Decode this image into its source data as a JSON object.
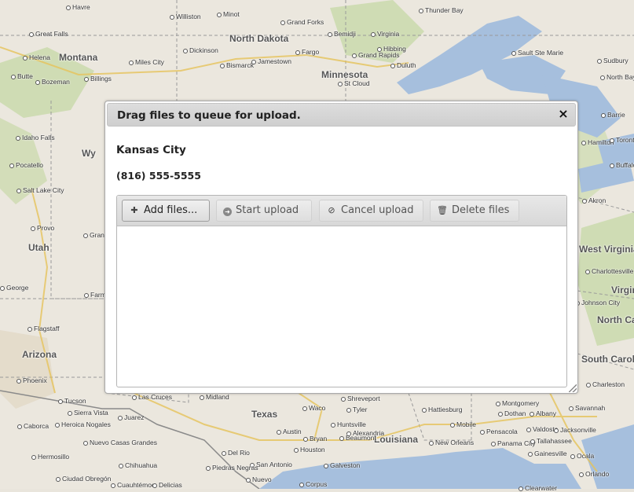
{
  "map": {
    "labels": [
      {
        "text": "Havre",
        "cls": ""
      },
      {
        "text": "Williston",
        "cls": ""
      },
      {
        "text": "Minot",
        "cls": ""
      },
      {
        "text": "Grand Forks",
        "cls": ""
      },
      {
        "text": "Thunder Bay",
        "cls": ""
      },
      {
        "text": "Great Falls",
        "cls": ""
      },
      {
        "text": "North Dakota",
        "cls": "state"
      },
      {
        "text": "Bemidji",
        "cls": ""
      },
      {
        "text": "Virginia",
        "cls": ""
      },
      {
        "text": "Montana",
        "cls": "state"
      },
      {
        "text": "Helena",
        "cls": ""
      },
      {
        "text": "Miles City",
        "cls": ""
      },
      {
        "text": "Dickinson",
        "cls": ""
      },
      {
        "text": "Bismarck",
        "cls": ""
      },
      {
        "text": "Jamestown",
        "cls": ""
      },
      {
        "text": "Fargo",
        "cls": ""
      },
      {
        "text": "Grand Rapids",
        "cls": ""
      },
      {
        "text": "Hibbing",
        "cls": ""
      },
      {
        "text": "Duluth",
        "cls": ""
      },
      {
        "text": "Sault Ste Marie",
        "cls": ""
      },
      {
        "text": "Sudbury",
        "cls": ""
      },
      {
        "text": "Butte",
        "cls": ""
      },
      {
        "text": "Bozeman",
        "cls": ""
      },
      {
        "text": "Billings",
        "cls": ""
      },
      {
        "text": "Minnesota",
        "cls": "state"
      },
      {
        "text": "St Cloud",
        "cls": ""
      },
      {
        "text": "North Bay",
        "cls": ""
      },
      {
        "text": "Idaho Falls",
        "cls": ""
      },
      {
        "text": "Wy",
        "cls": "state"
      },
      {
        "text": "Pocatello",
        "cls": ""
      },
      {
        "text": "Salt Lake City",
        "cls": ""
      },
      {
        "text": "Provo",
        "cls": ""
      },
      {
        "text": "Utah",
        "cls": "state"
      },
      {
        "text": "George",
        "cls": ""
      },
      {
        "text": "Flagstaff",
        "cls": ""
      },
      {
        "text": "Arizona",
        "cls": "state"
      },
      {
        "text": "Phoenix",
        "cls": ""
      },
      {
        "text": "Tucson",
        "cls": ""
      },
      {
        "text": "Sierra Vista",
        "cls": ""
      },
      {
        "text": "Caborca",
        "cls": ""
      },
      {
        "text": "Heroica Nogales",
        "cls": ""
      },
      {
        "text": "Las Cruces",
        "cls": ""
      },
      {
        "text": "Juarez",
        "cls": ""
      },
      {
        "text": "Midland",
        "cls": ""
      },
      {
        "text": "Texas",
        "cls": "state"
      },
      {
        "text": "Waco",
        "cls": ""
      },
      {
        "text": "Tyler",
        "cls": ""
      },
      {
        "text": "Shreveport",
        "cls": ""
      },
      {
        "text": "Alexandria",
        "cls": ""
      },
      {
        "text": "Hattiesburg",
        "cls": ""
      },
      {
        "text": "Montgomery",
        "cls": ""
      },
      {
        "text": "Savannah",
        "cls": ""
      },
      {
        "text": "Austin",
        "cls": ""
      },
      {
        "text": "Bryan",
        "cls": ""
      },
      {
        "text": "Huntsville",
        "cls": ""
      },
      {
        "text": "Louisiana",
        "cls": "state"
      },
      {
        "text": "Mobile",
        "cls": ""
      },
      {
        "text": "Pensacola",
        "cls": ""
      },
      {
        "text": "Valdosta",
        "cls": ""
      },
      {
        "text": "Jacksonville",
        "cls": ""
      },
      {
        "text": "Houston",
        "cls": ""
      },
      {
        "text": "Beaumont",
        "cls": ""
      },
      {
        "text": "New Orleans",
        "cls": ""
      },
      {
        "text": "Panama City",
        "cls": ""
      },
      {
        "text": "Tallahassee",
        "cls": ""
      },
      {
        "text": "Gainesville",
        "cls": ""
      },
      {
        "text": "Ocala",
        "cls": ""
      },
      {
        "text": "Hermosillo",
        "cls": ""
      },
      {
        "text": "Nuevo Casas Grandes",
        "cls": ""
      },
      {
        "text": "Chihuahua",
        "cls": ""
      },
      {
        "text": "Del Rio",
        "cls": ""
      },
      {
        "text": "San Antonio",
        "cls": ""
      },
      {
        "text": "Galveston",
        "cls": ""
      },
      {
        "text": "Piedras Negras",
        "cls": ""
      },
      {
        "text": "Nuevo",
        "cls": ""
      },
      {
        "text": "Ciudad Obregón",
        "cls": ""
      },
      {
        "text": "Cuauhtémoc",
        "cls": ""
      },
      {
        "text": "Delicias",
        "cls": ""
      },
      {
        "text": "Corpus",
        "cls": ""
      },
      {
        "text": "Orlando",
        "cls": ""
      },
      {
        "text": "Clearwater",
        "cls": ""
      },
      {
        "text": "Dothan",
        "cls": ""
      },
      {
        "text": "Albany",
        "cls": ""
      },
      {
        "text": "Barrie",
        "cls": ""
      },
      {
        "text": "Hamilton",
        "cls": ""
      },
      {
        "text": "Toronto",
        "cls": ""
      },
      {
        "text": "Buffalo",
        "cls": ""
      },
      {
        "text": "Akron",
        "cls": ""
      },
      {
        "text": "West Virginia",
        "cls": "state"
      },
      {
        "text": "Charlottesville",
        "cls": ""
      },
      {
        "text": "Virginia",
        "cls": "state"
      },
      {
        "text": "North Carolina",
        "cls": "state"
      },
      {
        "text": "South Carolina",
        "cls": "state"
      },
      {
        "text": "Charleston",
        "cls": ""
      },
      {
        "text": "Farmin",
        "cls": ""
      },
      {
        "text": "Grand Junction",
        "cls": ""
      },
      {
        "text": "Johnson City",
        "cls": ""
      }
    ]
  },
  "dialog": {
    "title": "Drag files to queue for upload.",
    "close_glyph": "×",
    "city": "Kansas City",
    "phone": "(816) 555-5555"
  },
  "uploader": {
    "add_label": "Add files...",
    "start_label": "Start upload",
    "cancel_label": "Cancel upload",
    "delete_label": "Delete files",
    "icons": {
      "add": "plus-icon",
      "start": "arrow-circle-icon",
      "cancel": "cancel-circle-icon",
      "delete": "trash-icon"
    }
  }
}
